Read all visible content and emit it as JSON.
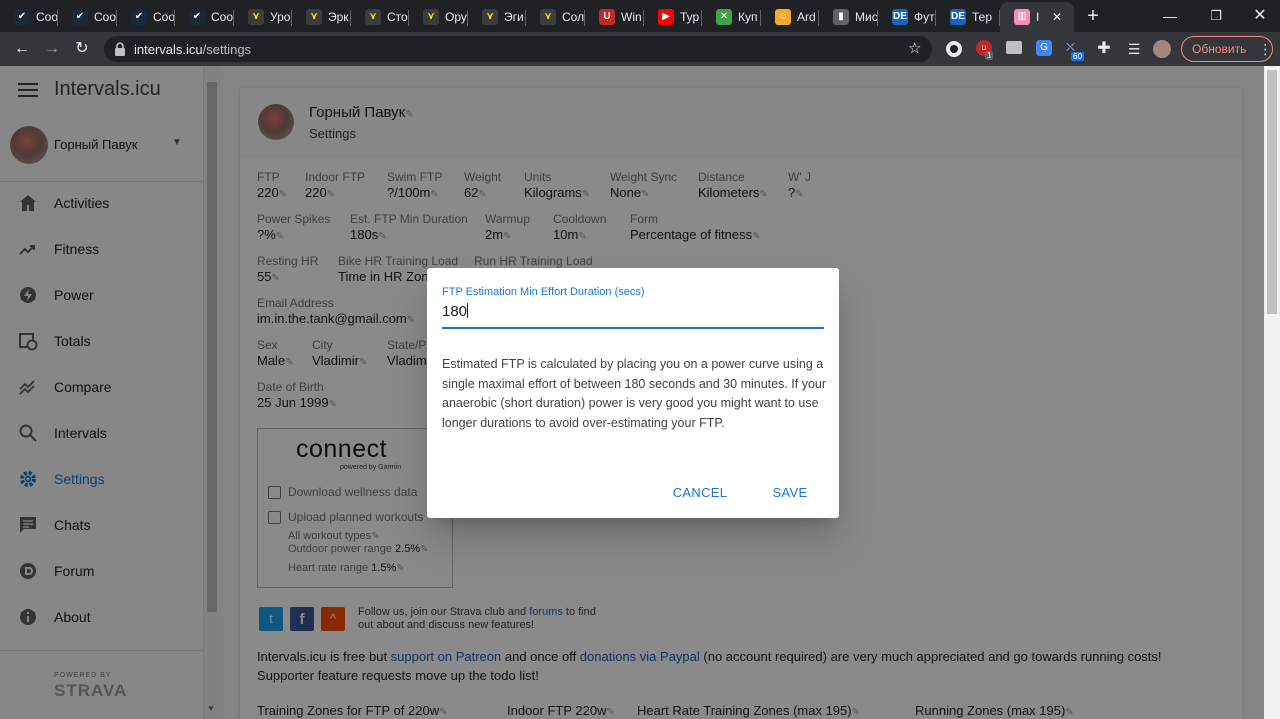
{
  "browser": {
    "tabs": [
      {
        "label": "Coo",
        "icon": "steam-icon",
        "color": "#1b2838"
      },
      {
        "label": "Coo",
        "icon": "steam-icon",
        "color": "#1b2838"
      },
      {
        "label": "Coo",
        "icon": "steam-icon",
        "color": "#1b2838"
      },
      {
        "label": "Coo",
        "icon": "steam-icon",
        "color": "#1b2838"
      },
      {
        "label": "Уро",
        "icon": "yellow-hanger-icon",
        "color": "#3c3c3c"
      },
      {
        "label": "Эрк",
        "icon": "yellow-hanger-icon",
        "color": "#3c3c3c"
      },
      {
        "label": "Сто",
        "icon": "yellow-hanger-icon",
        "color": "#3c3c3c"
      },
      {
        "label": "Ору",
        "icon": "yellow-hanger-icon",
        "color": "#3c3c3c"
      },
      {
        "label": "Эги",
        "icon": "yellow-hanger-icon",
        "color": "#3c3c3c"
      },
      {
        "label": "Сол",
        "icon": "yellow-hanger-icon",
        "color": "#3c3c3c"
      },
      {
        "label": "Win",
        "icon": "red-circle-icon",
        "color": "#c62828"
      },
      {
        "label": "Тур",
        "icon": "youtube-icon",
        "color": "#ff0000"
      },
      {
        "label": "Куп",
        "icon": "green-x-icon",
        "color": "#43a047"
      },
      {
        "label": "Ard",
        "icon": "smiley-icon",
        "color": "#f9a825"
      },
      {
        "label": "Мис",
        "icon": "robot-icon",
        "color": "#5f6368"
      },
      {
        "label": "Фут",
        "icon": "de-icon",
        "color": "#1565c0"
      },
      {
        "label": "Тер",
        "icon": "de-icon",
        "color": "#1565c0"
      },
      {
        "label": "I",
        "icon": "intervals-icon",
        "color": "#f48fb1"
      }
    ],
    "url_host": "intervals.icu",
    "url_path": "/settings",
    "update_label": "Обновить",
    "ext_badge_1": "1",
    "ext_badge_2": "60"
  },
  "sidebar": {
    "app_title": "Intervals.icu",
    "user_name": "Горный Павук",
    "items": [
      {
        "label": "Activities",
        "icon": "home-icon"
      },
      {
        "label": "Fitness",
        "icon": "trending-up-icon"
      },
      {
        "label": "Power",
        "icon": "bolt-icon"
      },
      {
        "label": "Totals",
        "icon": "calendar-clock-icon"
      },
      {
        "label": "Compare",
        "icon": "compare-icon"
      },
      {
        "label": "Intervals",
        "icon": "search-icon"
      },
      {
        "label": "Settings",
        "icon": "gear-icon"
      },
      {
        "label": "Chats",
        "icon": "chat-icon"
      },
      {
        "label": "Forum",
        "icon": "forum-icon"
      },
      {
        "label": "About",
        "icon": "info-icon"
      }
    ],
    "strava_powered": "POWERED BY",
    "strava_name": "STRAVA"
  },
  "settings": {
    "name": "Горный Павук",
    "subtitle": "Settings",
    "row1": [
      {
        "label": "FTP",
        "value": "220"
      },
      {
        "label": "Indoor FTP",
        "value": "220"
      },
      {
        "label": "Swim FTP",
        "value": "?/100m"
      },
      {
        "label": "Weight",
        "value": "62"
      },
      {
        "label": "Units",
        "value": "Kilograms"
      },
      {
        "label": "Weight Sync",
        "value": "None"
      },
      {
        "label": "Distance",
        "value": "Kilometers"
      },
      {
        "label": "W' J",
        "value": "?"
      }
    ],
    "row2": [
      {
        "label": "Power Spikes",
        "value": "?%"
      },
      {
        "label": "Est. FTP Min Duration",
        "value": "180s"
      },
      {
        "label": "Warmup",
        "value": "2m"
      },
      {
        "label": "Cooldown",
        "value": "10m"
      },
      {
        "label": "Form",
        "value": "Percentage of fitness"
      }
    ],
    "row3": [
      {
        "label": "Resting HR",
        "value": "55"
      },
      {
        "label": "Bike HR Training Load",
        "value": "Time in HR Zon"
      },
      {
        "label": "Run HR Training Load",
        "value": ""
      }
    ],
    "email_label": "Email Address",
    "email_value": "im.in.the.tank@gmail.com",
    "row5": [
      {
        "label": "Sex",
        "value": "Male"
      },
      {
        "label": "City",
        "value": "Vladimir"
      },
      {
        "label": "State/Pr",
        "value": "Vladim"
      }
    ],
    "dob_label": "Date of Birth",
    "dob_value": "25 Jun 1999",
    "garmin": {
      "logo": "connect",
      "sub": "powered by Garmin",
      "download": "Download wellness data",
      "upload": "Upload planned workouts",
      "workout_types": "All workout types",
      "outdoor_label": "Outdoor power range",
      "outdoor_value": "2.5%",
      "hr_label": "Heart rate range",
      "hr_value": "1.5%"
    },
    "follow_text_1": "Follow us, join our Strava club and ",
    "follow_link": "forums",
    "follow_text_2": " to find",
    "follow_text_3": "out about and discuss new features!",
    "support_1": "Intervals.icu is free but ",
    "support_link_1": "support on Patreon",
    "support_2": " and once off ",
    "support_link_2": "donations via Paypal",
    "support_3": " (no account required) are very much appreciated and go towards running costs!",
    "support_line2": "Supporter feature requests move up the todo list!",
    "zones": [
      "Training Zones for FTP of 220w",
      "Indoor FTP 220w",
      "Heart Rate Training Zones (max 195)",
      "Running Zones (max 195)"
    ]
  },
  "dialog": {
    "field_label": "FTP Estimation Min Effort Duration (secs)",
    "field_value": "180",
    "description": "Estimated FTP is calculated by placing you on a power curve using a single maximal effort of between 180 seconds and 30 minutes. If your anaerobic (short duration) power is very good you might want to use longer durations to avoid over-estimating your FTP.",
    "cancel_label": "CANCEL",
    "save_label": "SAVE"
  },
  "colors": {
    "accent": "#1976d2",
    "link": "#1565c0"
  }
}
